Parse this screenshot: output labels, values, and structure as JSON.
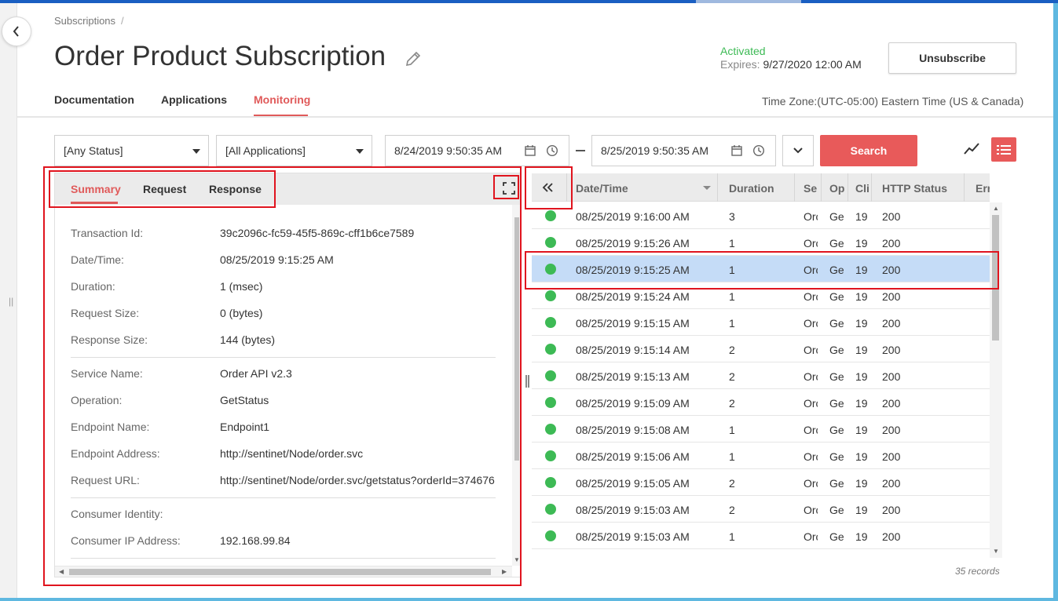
{
  "breadcrumb": {
    "root": "Subscriptions",
    "separator": "/"
  },
  "page": {
    "title": "Order Product Subscription"
  },
  "status": {
    "state": "Activated",
    "expires_label": "Expires:",
    "expires_value": "9/27/2020 12:00 AM"
  },
  "actions": {
    "unsubscribe_label": "Unsubscribe"
  },
  "nav": {
    "tabs": [
      {
        "label": "Documentation"
      },
      {
        "label": "Applications"
      },
      {
        "label": "Monitoring"
      }
    ],
    "active_index": 2
  },
  "timezone": "Time Zone:(UTC-05:00) Eastern Time (US & Canada)",
  "filters": {
    "status_select": "[Any Status]",
    "application_select": "[All Applications]",
    "date_from": "8/24/2019 9:50:35 AM",
    "date_to": "8/25/2019 9:50:35 AM",
    "search_label": "Search"
  },
  "detail": {
    "tabs": [
      "Summary",
      "Request",
      "Response"
    ],
    "active_tab": "Summary",
    "fields": [
      {
        "label": "Transaction Id:",
        "value": "39c2096c-fc59-45f5-869c-cff1b6ce7589"
      },
      {
        "label": "Date/Time:",
        "value": "08/25/2019 9:15:25 AM"
      },
      {
        "label": "Duration:",
        "value": "1 (msec)"
      },
      {
        "label": "Request Size:",
        "value": "0 (bytes)"
      },
      {
        "label": "Response Size:",
        "value": "144 (bytes)"
      },
      {
        "label": "Service Name:",
        "value": "Order API v2.3"
      },
      {
        "label": "Operation:",
        "value": "GetStatus"
      },
      {
        "label": "Endpoint Name:",
        "value": "Endpoint1"
      },
      {
        "label": "Endpoint Address:",
        "value": "http://sentinet/Node/order.svc"
      },
      {
        "label": "Request URL:",
        "value": "http://sentinet/Node/order.svc/getstatus?orderId=374676"
      },
      {
        "label": "Consumer Identity:",
        "value": ""
      },
      {
        "label": "Consumer IP Address:",
        "value": "192.168.99.84"
      }
    ]
  },
  "grid": {
    "columns": [
      "Date/Time",
      "Duration",
      "Se",
      "Op",
      "Cli",
      "HTTP Status",
      "Err"
    ],
    "rows": [
      {
        "datetime": "08/25/2019 9:16:00 AM",
        "duration": "3",
        "se": "Orc",
        "op": "Ge",
        "cli": "19",
        "http": "200"
      },
      {
        "datetime": "08/25/2019 9:15:26 AM",
        "duration": "1",
        "se": "Orc",
        "op": "Ge",
        "cli": "19",
        "http": "200"
      },
      {
        "datetime": "08/25/2019 9:15:25 AM",
        "duration": "1",
        "se": "Orc",
        "op": "Ge",
        "cli": "19",
        "http": "200"
      },
      {
        "datetime": "08/25/2019 9:15:24 AM",
        "duration": "1",
        "se": "Orc",
        "op": "Ge",
        "cli": "19",
        "http": "200"
      },
      {
        "datetime": "08/25/2019 9:15:15 AM",
        "duration": "1",
        "se": "Orc",
        "op": "Ge",
        "cli": "19",
        "http": "200"
      },
      {
        "datetime": "08/25/2019 9:15:14 AM",
        "duration": "2",
        "se": "Orc",
        "op": "Ge",
        "cli": "19",
        "http": "200"
      },
      {
        "datetime": "08/25/2019 9:15:13 AM",
        "duration": "2",
        "se": "Orc",
        "op": "Ge",
        "cli": "19",
        "http": "200"
      },
      {
        "datetime": "08/25/2019 9:15:09 AM",
        "duration": "2",
        "se": "Orc",
        "op": "Ge",
        "cli": "19",
        "http": "200"
      },
      {
        "datetime": "08/25/2019 9:15:08 AM",
        "duration": "1",
        "se": "Orc",
        "op": "Ge",
        "cli": "19",
        "http": "200"
      },
      {
        "datetime": "08/25/2019 9:15:06 AM",
        "duration": "1",
        "se": "Orc",
        "op": "Ge",
        "cli": "19",
        "http": "200"
      },
      {
        "datetime": "08/25/2019 9:15:05 AM",
        "duration": "2",
        "se": "Orc",
        "op": "Ge",
        "cli": "19",
        "http": "200"
      },
      {
        "datetime": "08/25/2019 9:15:03 AM",
        "duration": "2",
        "se": "Orc",
        "op": "Ge",
        "cli": "19",
        "http": "200"
      },
      {
        "datetime": "08/25/2019 9:15:03 AM",
        "duration": "1",
        "se": "Orc",
        "op": "Ge",
        "cli": "19",
        "http": "200"
      }
    ],
    "selected_index": 2,
    "record_count": "35 records"
  },
  "icons": {
    "back": "chevron-left-icon",
    "edit": "pencil-icon",
    "calendar": "calendar-icon",
    "clock": "clock-icon",
    "expand": "chevron-down-icon",
    "chart": "line-chart-icon",
    "list": "list-icon",
    "fullscreen": "fullscreen-icon",
    "collapse": "double-chevron-left-icon"
  },
  "colors": {
    "accent": "#e85a5a",
    "status_ok": "#3dba55",
    "selected_row": "#c5dcf7",
    "annotation": "#e0141e"
  }
}
